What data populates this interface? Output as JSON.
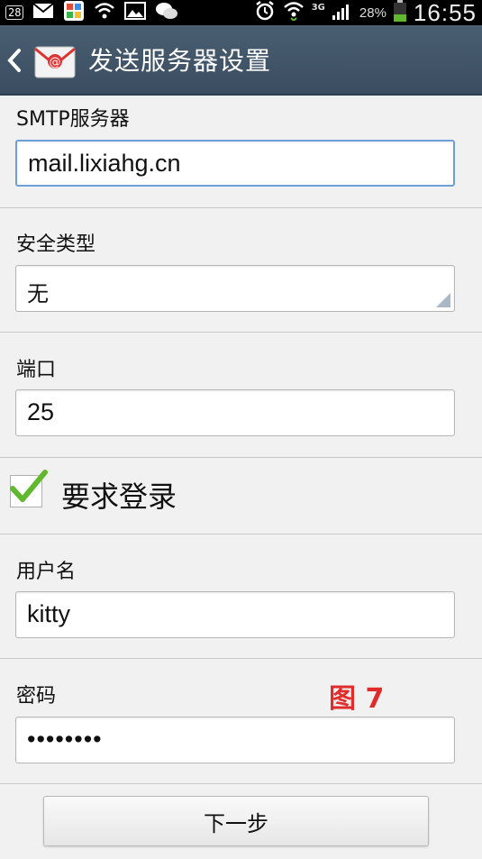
{
  "status_bar": {
    "notification_count": "28",
    "signal_type": "3G",
    "battery_percent": "28%",
    "time": "16:55",
    "icons": [
      "mail-icon",
      "calendar-icon",
      "wifi-icon",
      "gallery-icon",
      "wechat-icon",
      "alarm-icon",
      "wifi-data-icon",
      "signal-icon",
      "battery-icon"
    ]
  },
  "action_bar": {
    "title": "发送服务器设置"
  },
  "form": {
    "smtp_label": "SMTP服务器",
    "smtp_value": "mail.lixiahg.cn",
    "security_label": "安全类型",
    "security_value": "无",
    "port_label": "端口",
    "port_value": "25",
    "require_login_label": "要求登录",
    "require_login_checked": true,
    "username_label": "用户名",
    "username_value": "kitty",
    "password_label": "密码",
    "password_value": "••••••••",
    "figure_label": "图 7"
  },
  "buttons": {
    "next_label": "下一步"
  },
  "colors": {
    "action_bar": "#3f5367",
    "focus_border": "#6f9fd8",
    "checkmark": "#5fb82e",
    "figure_label": "#e12c2c"
  }
}
